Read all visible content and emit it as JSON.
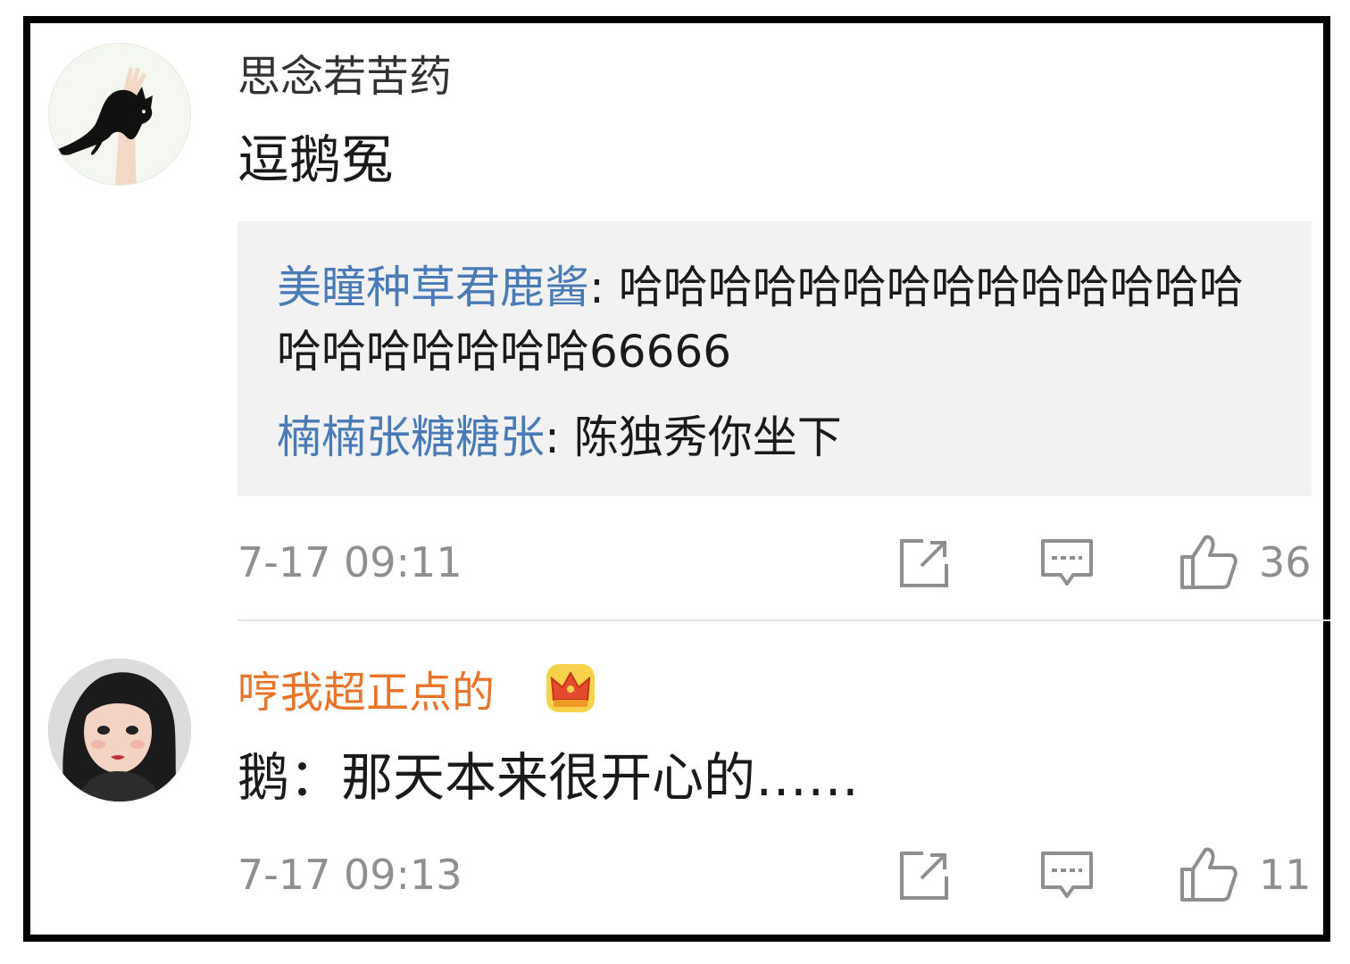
{
  "comments": [
    {
      "username": "思念若苦药",
      "text": "逗鹅冤",
      "replies": [
        {
          "user": "美瞳种草君鹿酱",
          "text": ": 哈哈哈哈哈哈哈哈哈哈哈哈哈哈哈哈哈哈哈哈哈66666"
        },
        {
          "user": "楠楠张糖糖张",
          "text": ": 陈独秀你坐下"
        }
      ],
      "timestamp": "7-17 09:11",
      "like_count": "36",
      "avatar_icon": "black-cat-avatar",
      "username_color": "#333333"
    },
    {
      "username": "哼我超正点的",
      "text": "鹅：那天本来很开心的……",
      "timestamp": "7-17 09:13",
      "like_count": "11",
      "avatar_icon": "girl-portrait-avatar",
      "badge_icon": "crown-icon",
      "username_color": "#e8742a"
    }
  ],
  "colors": {
    "reply_user": "#4a7bb7",
    "meta_gray": "#8f8f8f",
    "reply_bg": "#f2f2f2"
  }
}
